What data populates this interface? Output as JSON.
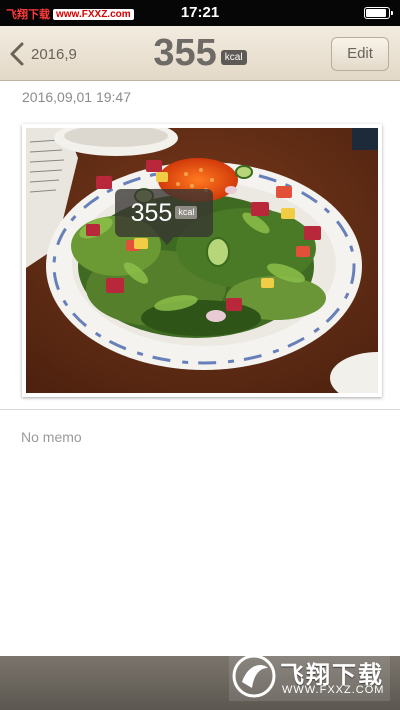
{
  "status_bar": {
    "watermark_brand": "飞翔下载",
    "watermark_url": "www.FXXZ.com",
    "time": "17:21",
    "battery_level_pct": 90
  },
  "nav": {
    "back_label": "2016,9",
    "calories": "355",
    "unit": "kcal",
    "edit_label": "Edit"
  },
  "entry": {
    "datetime": "2016,09,01 19:47",
    "photo_icon": "meal-photo",
    "overlay_calories": "355",
    "overlay_unit": "kcal",
    "memo": "No memo"
  },
  "watermark": {
    "title": "飞翔下载",
    "url": "WWW.FXXZ.COM"
  },
  "colors": {
    "nav_background": "#e8dfd0",
    "title_text": "#6e6b67",
    "bottom_bar": "#6b655e"
  }
}
